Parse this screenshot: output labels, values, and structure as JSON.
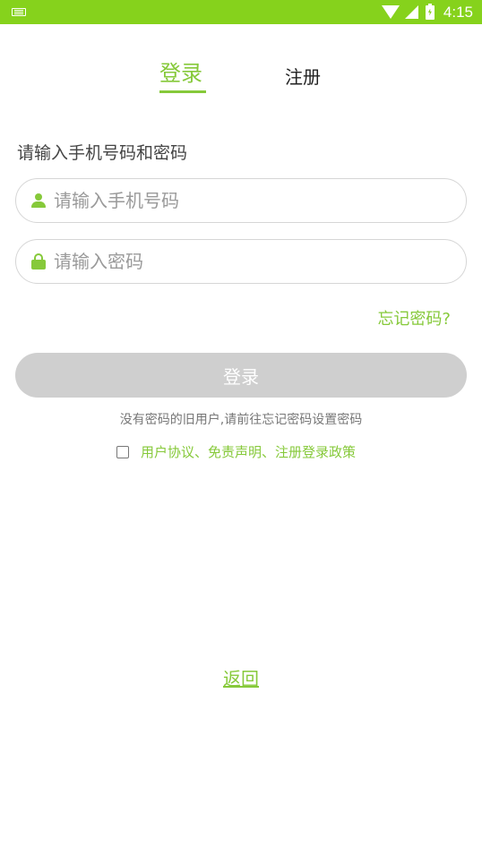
{
  "status_bar": {
    "time": "4:15",
    "icons": [
      "keyboard-icon",
      "wifi-icon",
      "signal-icon",
      "battery-charging-icon"
    ]
  },
  "tabs": {
    "login": "登录",
    "register": "注册"
  },
  "form": {
    "title": "请输入手机号码和密码",
    "phone_placeholder": "请输入手机号码",
    "password_placeholder": "请输入密码",
    "forgot_password": "忘记密码?",
    "login_button": "登录",
    "notice": "没有密码的旧用户,请前往忘记密码设置密码",
    "agreement": "用户协议、免责声明、注册登录政策",
    "agreement_checked": false
  },
  "footer": {
    "back": "返回"
  },
  "colors": {
    "accent": "#86c93a",
    "status_bar": "#86d21c",
    "button_disabled": "#cfcfcf"
  }
}
